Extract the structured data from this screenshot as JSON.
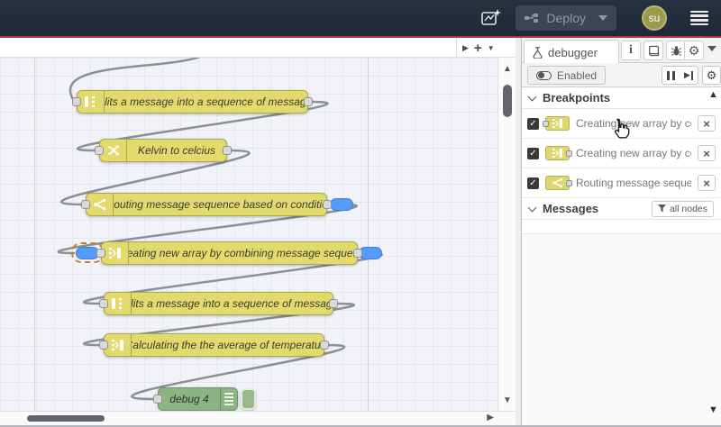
{
  "header": {
    "deploy_label": "Deploy",
    "avatar_initials": "su",
    "colors": {
      "bar": "#222d3c",
      "accent_red": "#b5323c",
      "deploy_bg": "#3b4554"
    }
  },
  "tabbar": {
    "play": "▶",
    "plus": "+",
    "caret": "▼"
  },
  "workspace": {
    "node_colors": {
      "function_yellow": "#e3da6e",
      "debug_green": "#8cb383",
      "breakpoint_blue": "#559bf7",
      "wire_gray": "#8b8f96"
    },
    "nodes": [
      {
        "type": "split",
        "label": "Splits a message into a sequence of messages."
      },
      {
        "type": "change",
        "label": "Kelvin to celcius"
      },
      {
        "type": "switch",
        "label": "Routing message sequence based on condition",
        "breakpoints": [
          "output"
        ]
      },
      {
        "type": "join",
        "label": "Creating new array by combining message sequence",
        "breakpoints": [
          "input",
          "output"
        ],
        "selected_breakpoint": "input"
      },
      {
        "type": "split",
        "label": "Splits a message into a sequence of messages."
      },
      {
        "type": "join",
        "label": "Calculating the the average of temperature"
      },
      {
        "type": "debug",
        "label": "debug 4"
      }
    ]
  },
  "sidebar": {
    "tab_label": "debugger",
    "toolbar": {
      "enabled_label": "Enabled"
    },
    "breakpoints": {
      "title": "Breakpoints",
      "items": [
        {
          "checked": true,
          "node_type": "join",
          "port": "input",
          "label": "Creating new array by combining message sequence"
        },
        {
          "checked": true,
          "node_type": "join",
          "port": "output",
          "label": "Creating new array by combining message sequence"
        },
        {
          "checked": true,
          "node_type": "switch",
          "port": "output",
          "label": "Routing message sequence based on condition"
        }
      ]
    },
    "messages": {
      "title": "Messages",
      "filter_label": "all nodes"
    }
  },
  "icons": {
    "check": "✓",
    "close": "×",
    "gear": "⚙",
    "info": "i",
    "up_triangle": "▲",
    "down_triangle": "▼",
    "right_triangle": "▶"
  }
}
